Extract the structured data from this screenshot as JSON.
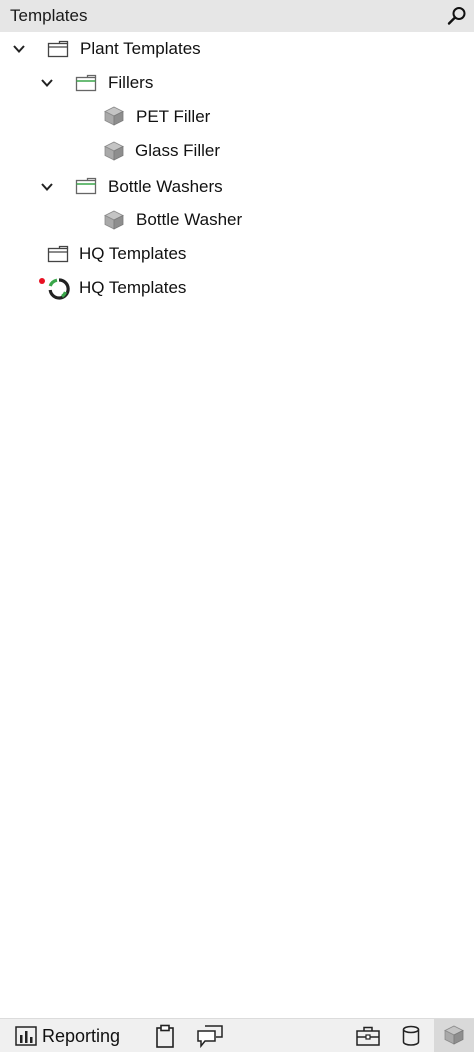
{
  "panel": {
    "title": "Templates",
    "search_icon": "search-icon"
  },
  "tree": {
    "nodes": [
      {
        "label": "Plant Templates",
        "icon": "folder-icon",
        "expanded": true
      },
      {
        "label": "Fillers",
        "icon": "folder-icon",
        "expanded": true
      },
      {
        "label": "PET Filler",
        "icon": "cube-icon"
      },
      {
        "label": "Glass Filler",
        "icon": "cube-icon"
      },
      {
        "label": "Bottle Washers",
        "icon": "folder-icon",
        "expanded": true
      },
      {
        "label": "Bottle Washer",
        "icon": "cube-icon"
      },
      {
        "label": "HQ Templates",
        "icon": "folder-icon"
      },
      {
        "label": "HQ Templates",
        "icon": "sync-loading-icon",
        "status_dot_color": "#e81123"
      }
    ]
  },
  "footer": {
    "reporting_label": "Reporting",
    "icons": [
      "bar-chart-icon",
      "clipboard-icon",
      "comments-icon",
      "toolbox-icon",
      "database-icon",
      "cube-icon"
    ]
  },
  "colors": {
    "header_bg": "#e6e6e6",
    "accent_green": "#3aa64a",
    "status_red": "#e81123"
  }
}
